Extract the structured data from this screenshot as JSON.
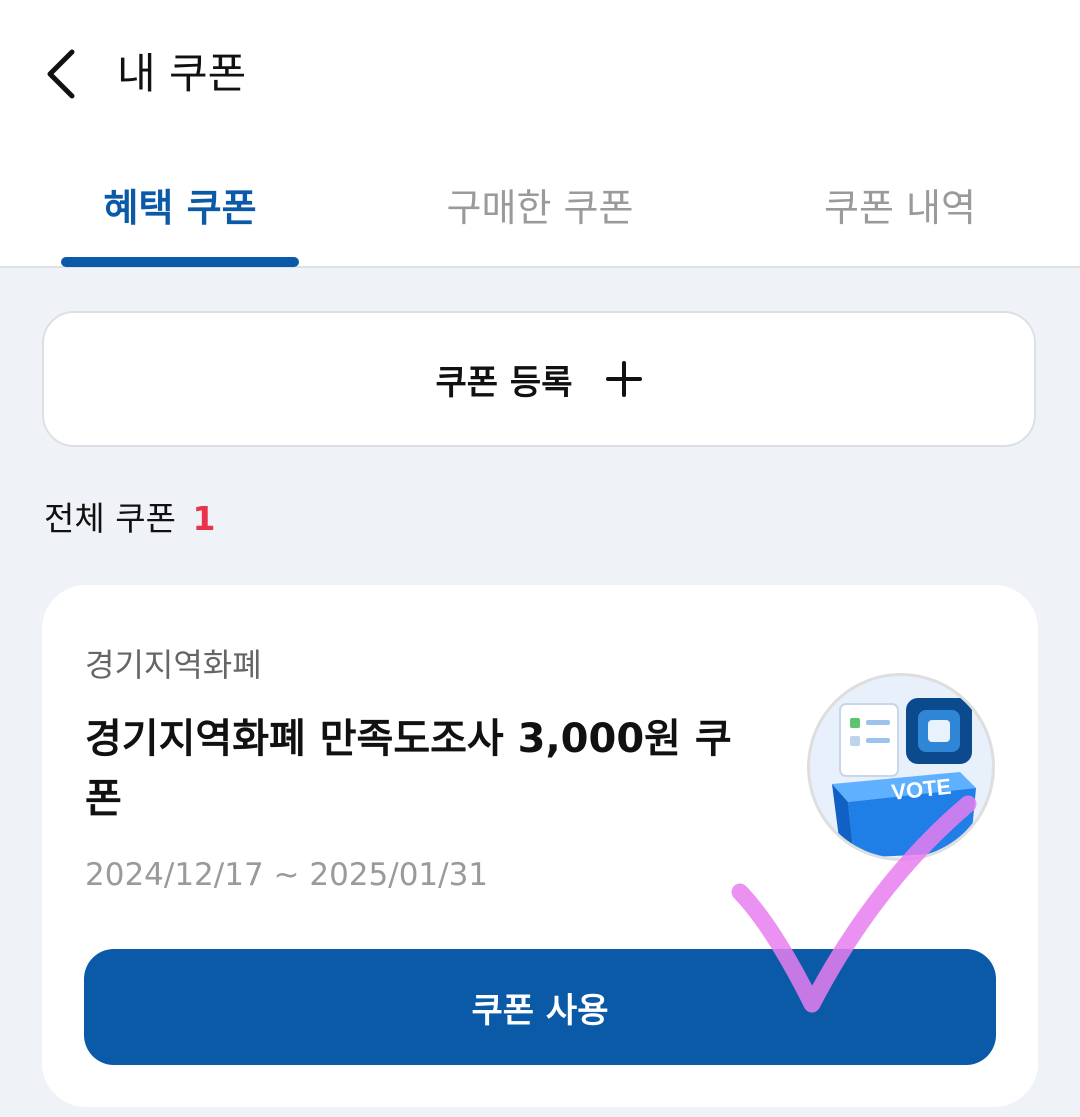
{
  "header": {
    "title": "내 쿠폰",
    "back_icon": "chevron-left-icon"
  },
  "tabs": [
    {
      "label": "혜택 쿠폰",
      "active": true
    },
    {
      "label": "구매한 쿠폰",
      "active": false
    },
    {
      "label": "쿠폰 내역",
      "active": false
    }
  ],
  "register": {
    "label": "쿠폰 등록",
    "icon": "plus-icon"
  },
  "count": {
    "label": "전체 쿠폰",
    "value": "1"
  },
  "coupon": {
    "issuer": "경기지역화폐",
    "title": "경기지역화폐 만족도조사 3,000원 쿠폰",
    "period": "2024/12/17 ~ 2025/01/31",
    "thumbnail_text": "VOTE",
    "use_label": "쿠폰 사용"
  },
  "colors": {
    "accent": "#0a5aa8",
    "count_highlight": "#e8334a",
    "annotation": "#e77ef0"
  }
}
